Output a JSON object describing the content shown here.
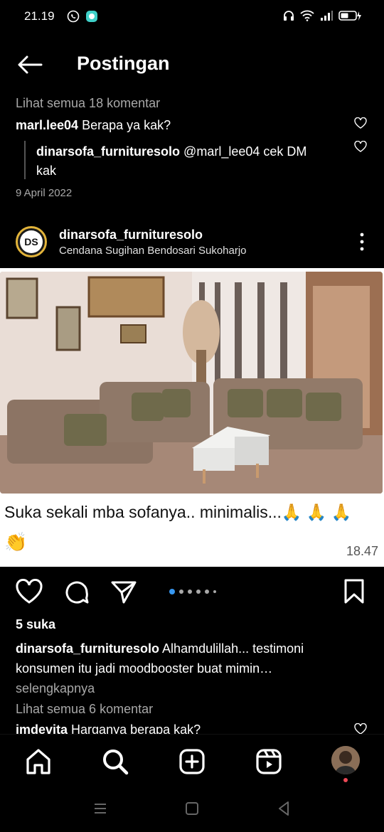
{
  "status_bar": {
    "time": "21.19"
  },
  "header": {
    "title": "Postingan"
  },
  "comments_top": {
    "view_all": "Lihat semua 18 komentar",
    "comment1_user": "marl.lee04",
    "comment1_text": "Berapa ya kak?",
    "reply_user": "dinarsofa_furnituresolo",
    "reply_text_line1": "@marl_lee04 cek DM",
    "reply_text_line2": "kak",
    "date": "9 April 2022"
  },
  "post": {
    "avatar_text": "DS",
    "username": "dinarsofa_furnituresolo",
    "location": "Cendana Sugihan Bendosari Sukoharjo",
    "caption_overlay": "Suka sekali mba sofanya.. minimalis...🙏 🙏 🙏",
    "caption_overlay_emoji": "👏",
    "caption_overlay_time": "18.47",
    "likes": "5 suka",
    "caption_user": "dinarsofa_furnituresolo",
    "caption_text_line1": "Alhamdulillah... testimoni",
    "caption_text_line2": "konsumen itu jadi moodbooster buat mimin…",
    "more": "selengkapnya",
    "view_comments": "Lihat semua 6 komentar",
    "last_comment_user": "imdevita",
    "last_comment_text": "Harganya berapa kak?"
  },
  "colors": {
    "accent": "#3797f0",
    "muted": "#a8a8a8",
    "notification": "#ed4956",
    "avatar_ring": "#e3b43a"
  },
  "icons": [
    "back-arrow-icon",
    "heart-icon",
    "comment-icon",
    "send-icon",
    "bookmark-icon",
    "home-icon",
    "search-icon",
    "create-icon",
    "reels-icon",
    "more-icon"
  ]
}
